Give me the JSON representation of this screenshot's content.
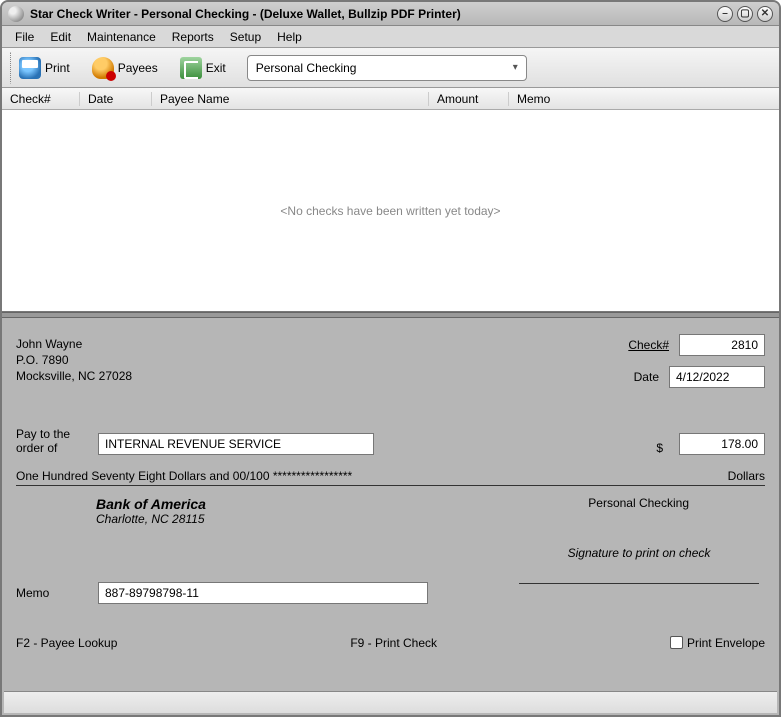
{
  "title": "Star Check Writer - Personal Checking - (Deluxe Wallet, Bullzip PDF Printer)",
  "menu": {
    "file": "File",
    "edit": "Edit",
    "maintenance": "Maintenance",
    "reports": "Reports",
    "setup": "Setup",
    "help": "Help"
  },
  "toolbar": {
    "print": "Print",
    "payees": "Payees",
    "exit": "Exit",
    "account": "Personal Checking"
  },
  "grid": {
    "columns": {
      "check": "Check#",
      "date": "Date",
      "payee": "Payee Name",
      "amount": "Amount",
      "memo": "Memo"
    },
    "empty_text": "<No checks have been written yet today>"
  },
  "check": {
    "address_line1": "John Wayne",
    "address_line2": "P.O. 7890",
    "address_line3": "Mocksville, NC  27028",
    "check_num_label": "Check#",
    "check_num": "2810",
    "date_label": "Date",
    "date": "4/12/2022",
    "payto_label1": "Pay to the",
    "payto_label2": "order of",
    "payee": "INTERNAL REVENUE SERVICE",
    "dollar_sign": "$",
    "amount": "178.00",
    "amount_words": "One Hundred Seventy Eight Dollars and 00/100 *****************",
    "dollars_label": "Dollars",
    "bank_name": "Bank of America",
    "bank_city": "Charlotte, NC 28115",
    "account_name": "Personal Checking",
    "signature_label": "Signature to print on check",
    "memo_label": "Memo",
    "memo": "887-89798798-11",
    "hint_f2": "F2 - Payee Lookup",
    "hint_f9": "F9 - Print Check",
    "print_envelope": "Print Envelope"
  }
}
